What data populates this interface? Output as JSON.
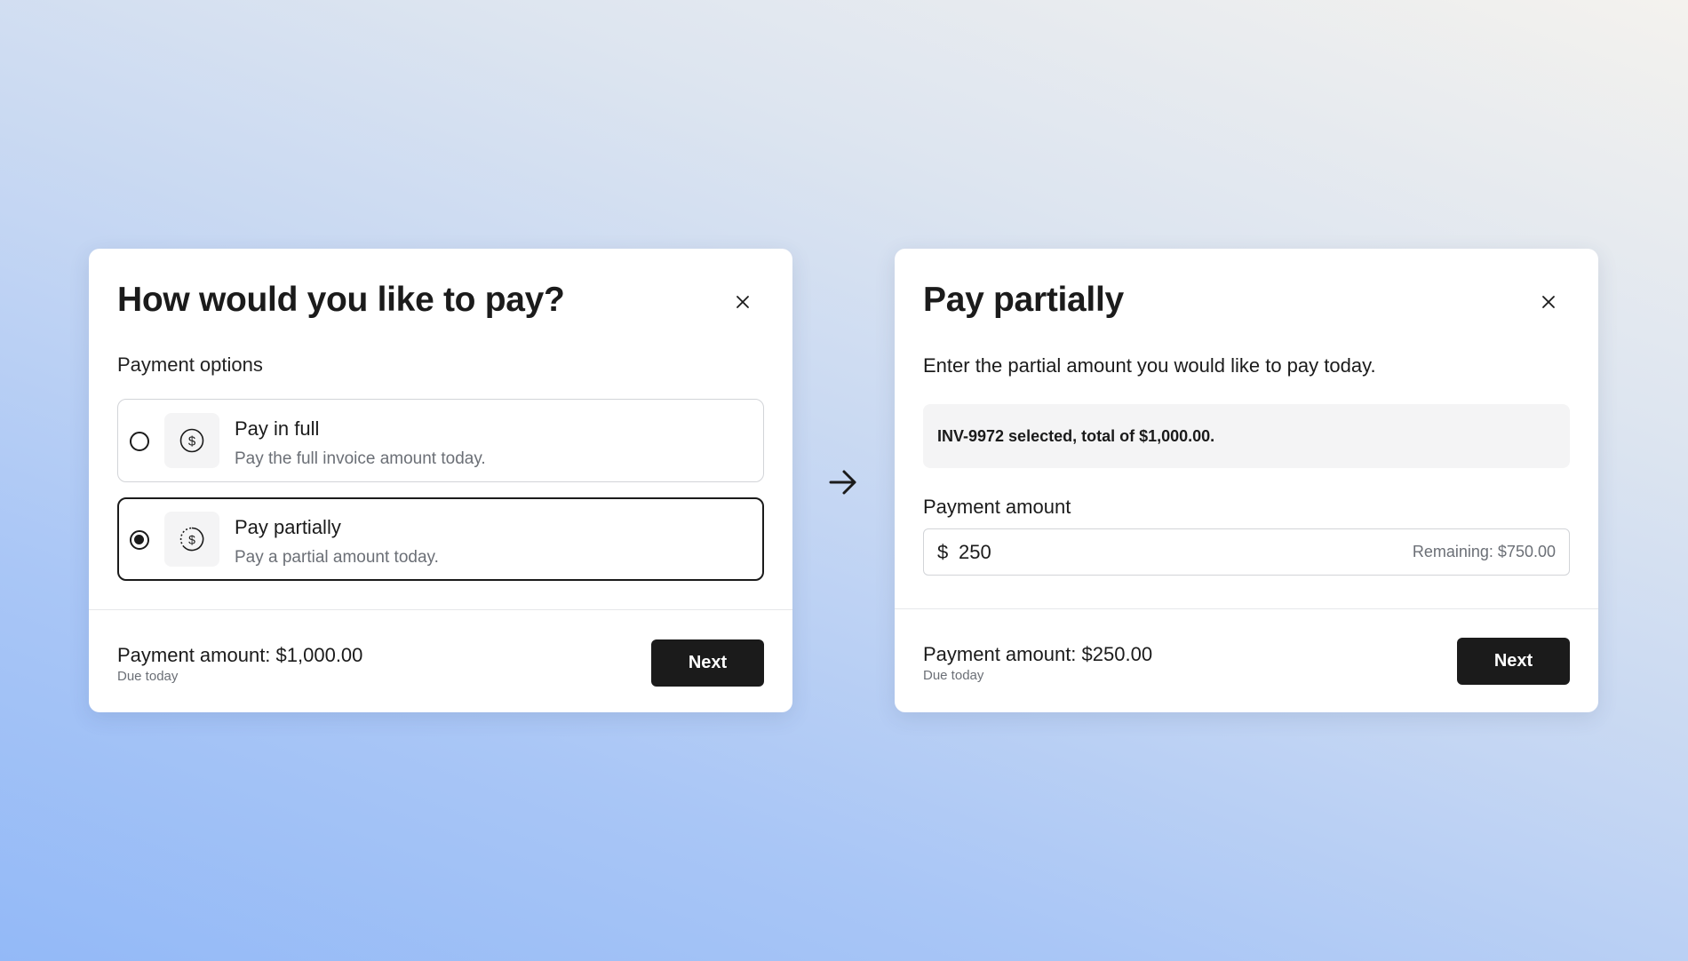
{
  "left_dialog": {
    "title": "How would you like to pay?",
    "section_label": "Payment options",
    "options": [
      {
        "title": "Pay in full",
        "description": "Pay the full invoice amount today.",
        "selected": false,
        "icon": "dollar-circle-icon"
      },
      {
        "title": "Pay partially",
        "description": "Pay a partial amount today.",
        "selected": true,
        "icon": "dollar-partial-circle-icon"
      }
    ],
    "footer": {
      "amount_label": "Payment amount: $1,000.00",
      "due_label": "Due today",
      "next_label": "Next"
    }
  },
  "flow_arrow": "arrow-right-icon",
  "right_dialog": {
    "title": "Pay partially",
    "subtitle": "Enter the partial amount you would like to pay today.",
    "invoice_summary": "INV-9972 selected, total of $1,000.00.",
    "field_label": "Payment amount",
    "input": {
      "currency_symbol": "$",
      "value": "250",
      "remaining": "Remaining: $750.00"
    },
    "footer": {
      "amount_label": "Payment amount: $250.00",
      "due_label": "Due today",
      "next_label": "Next"
    }
  },
  "colors": {
    "primary_button": "#1b1b1b",
    "muted_text": "#6b6f76",
    "border": "#d2d4d8",
    "panel_bg": "#f4f4f5"
  }
}
